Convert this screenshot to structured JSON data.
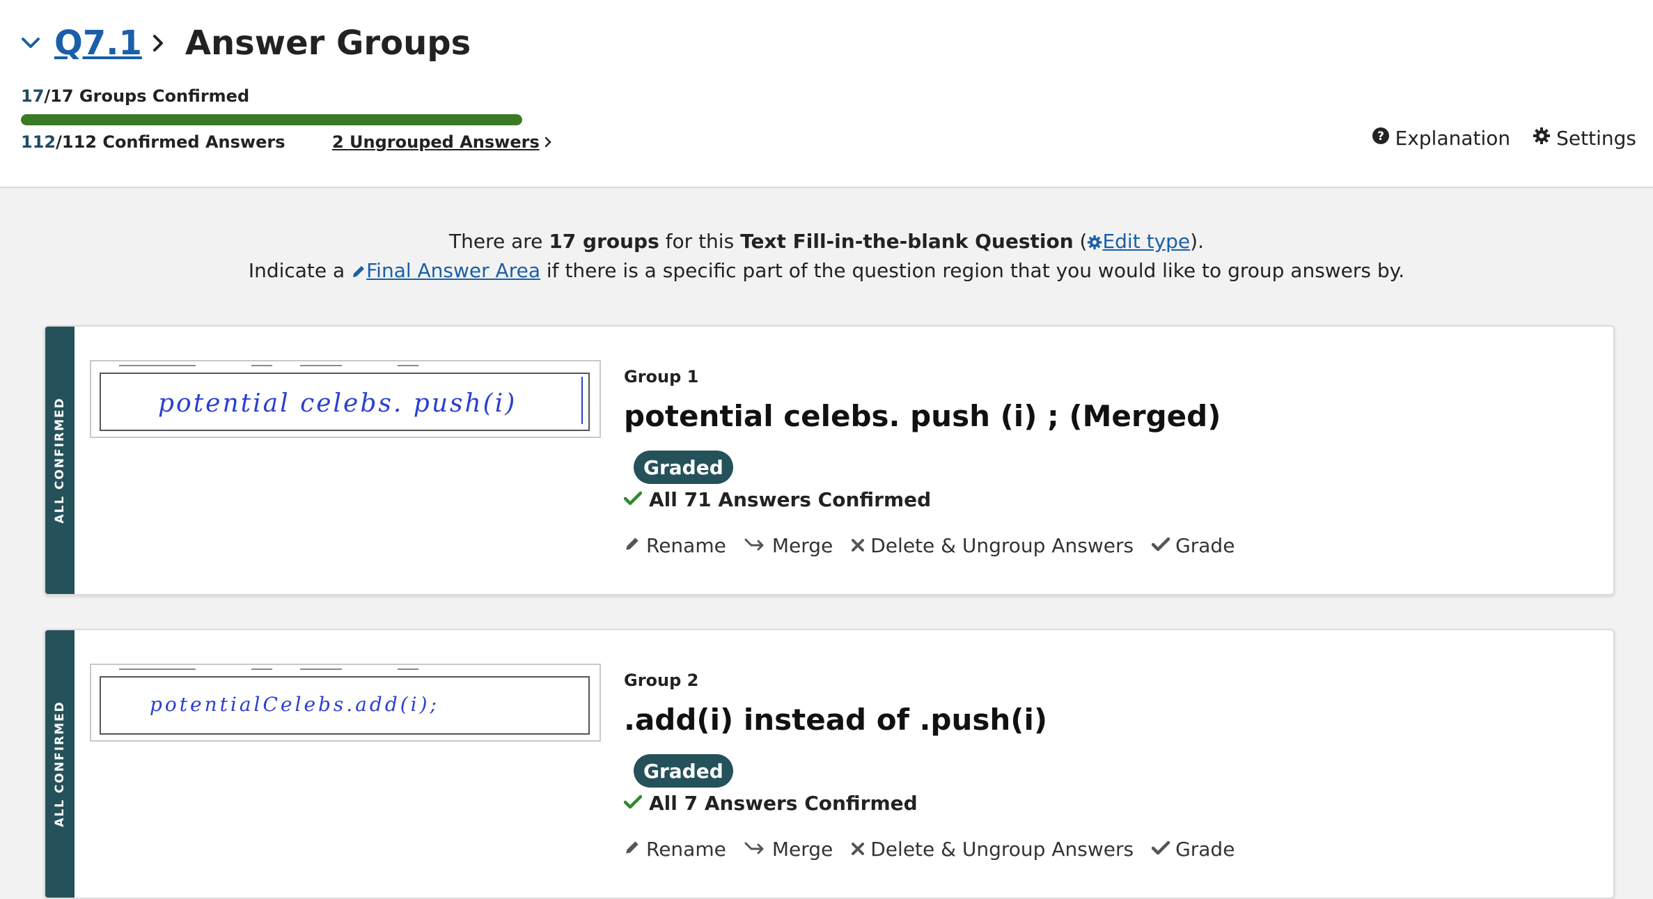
{
  "header": {
    "question_link": "Q7.1",
    "title": "Answer Groups",
    "groups_confirmed_count": "17",
    "groups_confirmed_rest": "/17 Groups Confirmed",
    "answers_confirmed_count": "112",
    "answers_confirmed_rest": "/112 Confirmed Answers",
    "progress_fraction": 1.0,
    "ungrouped_link": "2 Ungrouped Answers",
    "explanation_label": "Explanation",
    "settings_label": "Settings"
  },
  "info": {
    "l1_a": "There are ",
    "l1_b": "17 groups",
    "l1_c": " for this ",
    "l1_d": "Text Fill-in-the-blank Question",
    "l1_e": " (",
    "l1_link": "Edit type",
    "l1_f": ").",
    "l2_a": "Indicate a ",
    "l2_link": "Final Answer Area",
    "l2_b": " if there is a specific part of the question region that you would like to group answers by."
  },
  "groups": [
    {
      "status": "ALL CONFIRMED",
      "label": "Group 1",
      "title": "potential celebs. push (i) ; (Merged)",
      "badge": "Graded",
      "confirmed": "All 71 Answers Confirmed",
      "handwriting": "potential celebs. push(i)"
    },
    {
      "status": "ALL CONFIRMED",
      "label": "Group 2",
      "title": ".add(i) instead of .push(i)",
      "badge": "Graded",
      "confirmed": "All 7 Answers Confirmed",
      "handwriting": "potentialCelebs.add(i);"
    }
  ],
  "actions": {
    "rename": "Rename",
    "merge": "Merge",
    "delete": "Delete & Ungroup Answers",
    "grade": "Grade"
  },
  "colors": {
    "link": "#1a5fa8",
    "progress": "#3a7a25",
    "stripe": "#25525a",
    "check": "#2e8b2e"
  }
}
